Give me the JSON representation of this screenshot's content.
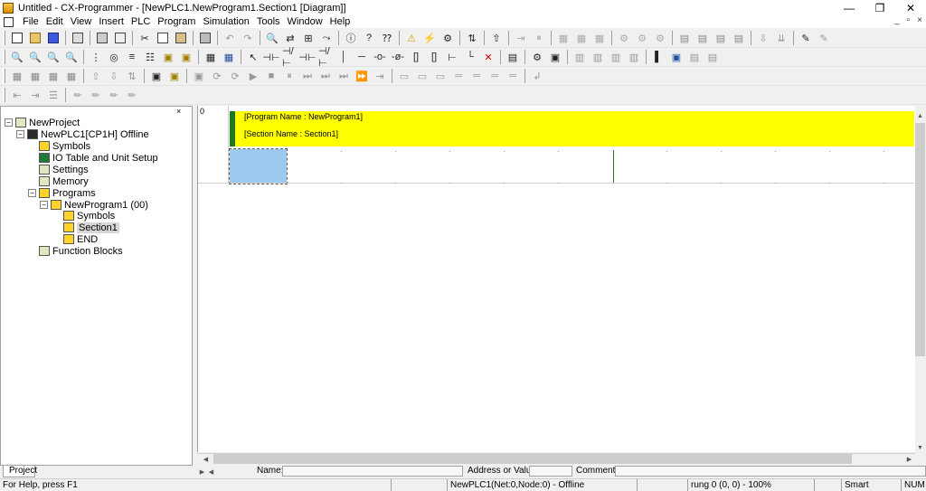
{
  "window": {
    "title": "Untitled - CX-Programmer - [NewPLC1.NewProgram1.Section1 [Diagram]]",
    "controls": [
      "—",
      "❐",
      "✕"
    ]
  },
  "menubar": {
    "items": [
      "File",
      "Edit",
      "View",
      "Insert",
      "PLC",
      "Program",
      "Simulation",
      "Tools",
      "Window",
      "Help"
    ],
    "mdi_controls": [
      "_",
      "▫",
      "×"
    ]
  },
  "project_tree": {
    "items": [
      {
        "label": "NewProject",
        "level": 0,
        "expander": "−",
        "icon": "project-icon"
      },
      {
        "label": "NewPLC1[CP1H] Offline",
        "level": 1,
        "expander": "−",
        "icon": "plc-icon"
      },
      {
        "label": "Symbols",
        "level": 2,
        "expander": "",
        "icon": "symbols-icon"
      },
      {
        "label": "IO Table and Unit Setup",
        "level": 2,
        "expander": "",
        "icon": "io-table-icon"
      },
      {
        "label": "Settings",
        "level": 2,
        "expander": "",
        "icon": "settings-icon"
      },
      {
        "label": "Memory",
        "level": 2,
        "expander": "",
        "icon": "memory-icon"
      },
      {
        "label": "Programs",
        "level": 2,
        "expander": "−",
        "icon": "programs-icon"
      },
      {
        "label": "NewProgram1 (00)",
        "level": 3,
        "expander": "−",
        "icon": "program-icon"
      },
      {
        "label": "Symbols",
        "level": 4,
        "expander": "",
        "icon": "symbols-icon"
      },
      {
        "label": "Section1",
        "level": 4,
        "expander": "",
        "icon": "section-icon",
        "selected": true
      },
      {
        "label": "END",
        "level": 4,
        "expander": "",
        "icon": "end-icon"
      },
      {
        "label": "Function Blocks",
        "level": 2,
        "expander": "",
        "icon": "function-blocks-icon"
      }
    ],
    "tab_label": "Project",
    "close_glyph": "×"
  },
  "diagram": {
    "rung_number": "0",
    "program_name_line": "[Program Name : NewProgram1]",
    "section_name_line": "[Section Name : Section1]"
  },
  "infobar": {
    "name_label": "Name:",
    "address_label": "Address or Value:",
    "comment_label": "Comment:"
  },
  "statusbar": {
    "help": "For Help, press F1",
    "plc_status": "NewPLC1(Net:0,Node:0) - Offline",
    "position": "rung 0 (0, 0)  - 100%",
    "mode": "Smart",
    "num": "NUM"
  }
}
